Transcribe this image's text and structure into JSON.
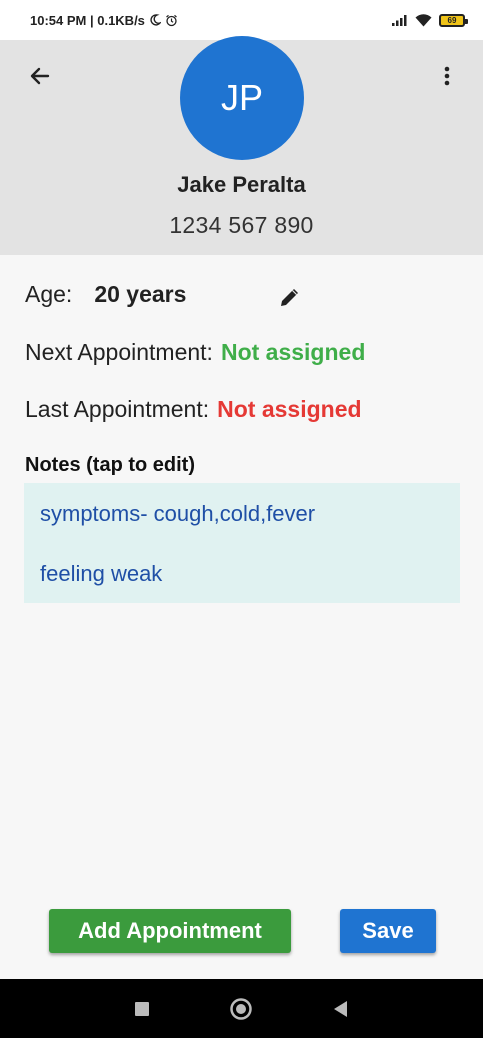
{
  "status_bar": {
    "time_speed": "10:54 PM | 0.1KB/s",
    "battery": "69"
  },
  "header": {
    "avatar_initials": "JP",
    "name": "Jake Peralta",
    "phone": "1234 567 890"
  },
  "details": {
    "age_label": "Age:",
    "age_value": "20 years",
    "next_label": "Next Appointment:",
    "next_value": "Not assigned",
    "last_label": "Last Appointment:",
    "last_value": "Not assigned"
  },
  "notes": {
    "label": "Notes (tap to edit)",
    "lines": [
      "symptoms- cough,cold,fever",
      "feeling weak"
    ]
  },
  "actions": {
    "add_label": "Add Appointment",
    "save_label": "Save"
  },
  "colors": {
    "primary": "#1f74d1",
    "success": "#3b9b3d",
    "green_text": "#3fae49",
    "red_text": "#e53935",
    "notes_bg": "#e0f2f1"
  }
}
